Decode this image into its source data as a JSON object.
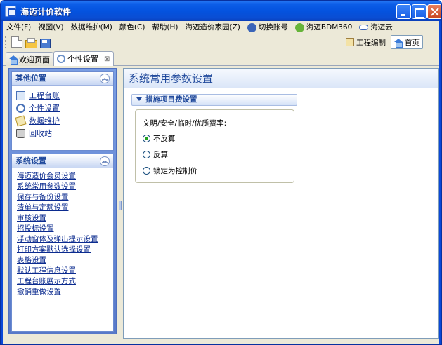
{
  "window": {
    "title": "海迈计价软件"
  },
  "menu": {
    "items": [
      "文件(F)",
      "视图(V)",
      "数据维护(M)",
      "颜色(C)",
      "帮助(H)",
      "海迈造价家园(Z)"
    ],
    "switch_account": "切换账号",
    "bdm360": "海迈BDM360",
    "cloud": "海迈云"
  },
  "toolbar": {
    "edit_label": "工程编制",
    "home_label": "首页"
  },
  "tabs": [
    {
      "label": "欢迎页面"
    },
    {
      "label": "个性设置",
      "close": "⊠"
    }
  ],
  "sidebar": {
    "other_locations": {
      "title": "其他位置",
      "items": [
        "工程台账",
        "个性设置",
        "数据维护",
        "回收站"
      ]
    },
    "system_settings": {
      "title": "系统设置",
      "items": [
        "海迈造价会员设置",
        "系统常用参数设置",
        "保存与备份设置",
        "清单与定额设置",
        "审核设置",
        "招投标设置",
        "浮动窗体及弹出提示设置",
        "打印方案默认选择设置",
        "表格设置",
        "默认工程信息设置",
        "工程台账展示方式",
        "撤销重做设置"
      ]
    },
    "collapse_glyph": "︽"
  },
  "main": {
    "title": "系统常用参数设置",
    "section": "措施项目费设置",
    "group_label": "文明/安全/临时/优质费率:",
    "options": [
      "不反算",
      "反算",
      "锁定为控制价"
    ],
    "selected_option": "不反算"
  },
  "colors": {
    "accent": "#214a9c",
    "titlebar": "#0453df",
    "link": "#0b2b8f"
  }
}
